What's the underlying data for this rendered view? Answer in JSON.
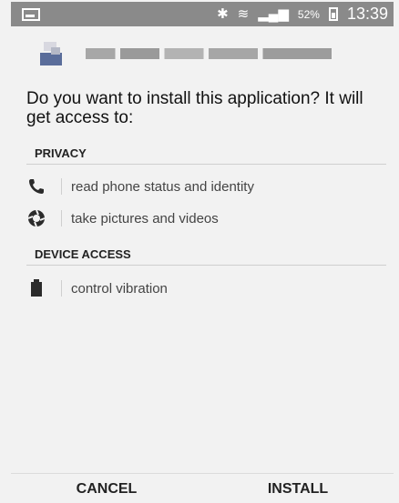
{
  "status_bar": {
    "battery_percent": "52%",
    "time": "13:39",
    "icons": [
      "screenshot-icon",
      "bluetooth-icon",
      "wifi-icon",
      "signal-icon",
      "battery-icon"
    ]
  },
  "dialog": {
    "question": "Do you want to install this application? It will get access to:",
    "sections": [
      {
        "title": "PRIVACY",
        "items": [
          {
            "icon": "phone-icon",
            "label": "read phone status and identity"
          },
          {
            "icon": "camera-icon",
            "label": "take pictures and videos"
          }
        ]
      },
      {
        "title": "DEVICE ACCESS",
        "items": [
          {
            "icon": "vibration-icon",
            "label": "control vibration"
          }
        ]
      }
    ]
  },
  "buttons": {
    "cancel": "CANCEL",
    "install": "INSTALL"
  }
}
